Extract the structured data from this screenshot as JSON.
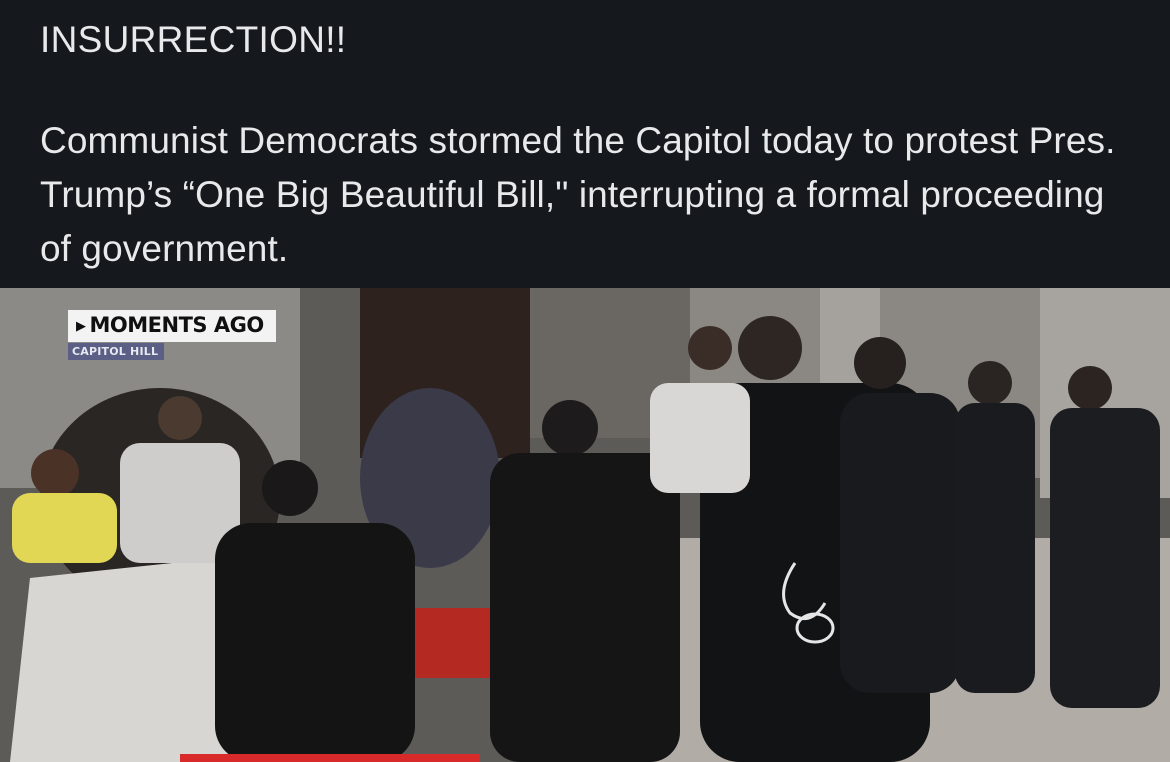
{
  "post": {
    "headline": "INSURRECTION!!",
    "body": "Communist Democrats stormed the Capitol today to protest Pres. Trump’s “One Big Beautiful Bill,\" interrupting a formal proceeding of government."
  },
  "media": {
    "overlay_badge_primary": "MOMENTS AGO",
    "overlay_badge_secondary": "CAPITOL HILL",
    "colors": {
      "background": "#15181d",
      "text": "#e7e9ea",
      "badge_secondary": "#5b5f86"
    }
  }
}
